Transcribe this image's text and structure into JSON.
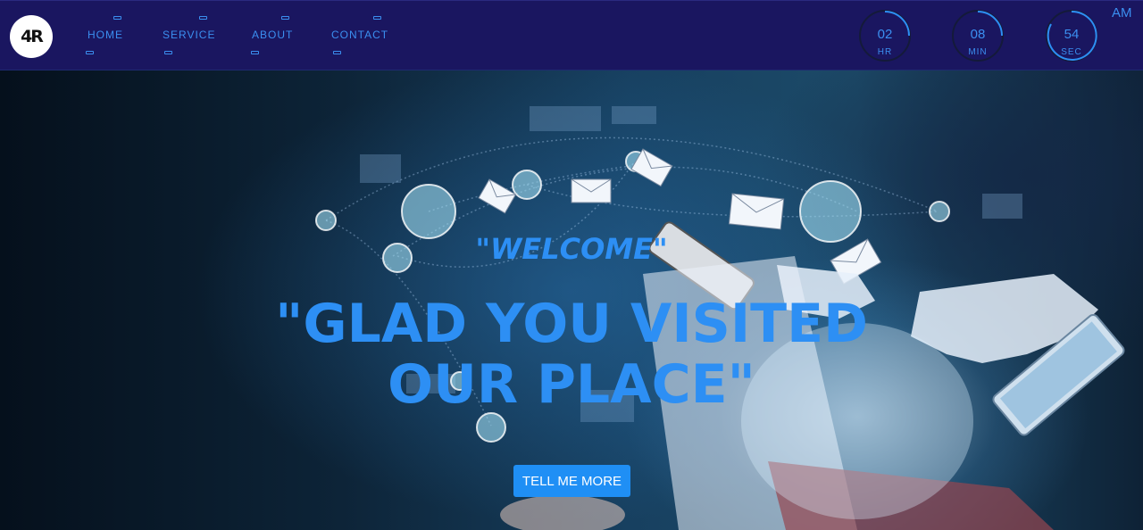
{
  "logo": {
    "text": "4R"
  },
  "nav": {
    "items": [
      {
        "label": "HOME"
      },
      {
        "label": "SERVICE"
      },
      {
        "label": "ABOUT"
      },
      {
        "label": "CONTACT"
      }
    ]
  },
  "clock": {
    "hours": {
      "value": "02",
      "label": "HR"
    },
    "minutes": {
      "value": "08",
      "label": "MIN"
    },
    "seconds": {
      "value": "54",
      "label": "SEC"
    },
    "period": "AM"
  },
  "hero": {
    "welcome": "\"WELCOME\"",
    "headline": "\"GLAD YOU VISITED OUR PLACE\"",
    "cta": "TELL ME MORE"
  },
  "colors": {
    "accent": "#2d8ff4",
    "navbar": "#1a1660",
    "button": "#1f8ff5"
  }
}
